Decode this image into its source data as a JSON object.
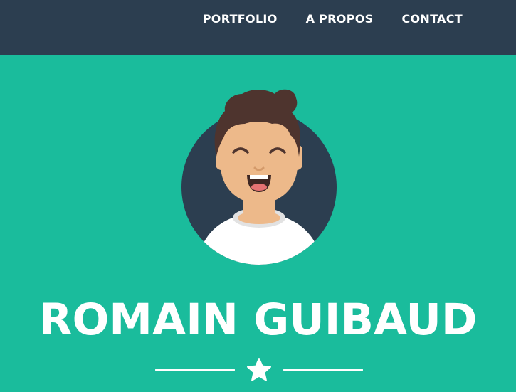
{
  "nav": {
    "items": [
      {
        "label": "PORTFOLIO"
      },
      {
        "label": "A PROPOS"
      },
      {
        "label": "CONTACT"
      }
    ]
  },
  "masthead": {
    "name": "ROMAIN GUIBAUD",
    "avatar_icon": "avatar-illustration",
    "divider_icon": "star-icon"
  },
  "colors": {
    "navbar_bg": "#2c3e50",
    "masthead_bg": "#1abc9c",
    "text": "#ffffff",
    "avatar_circle": "#2c3e50",
    "hair": "#4e342e",
    "skin": "#edb98a",
    "shirt": "#ffffff"
  }
}
